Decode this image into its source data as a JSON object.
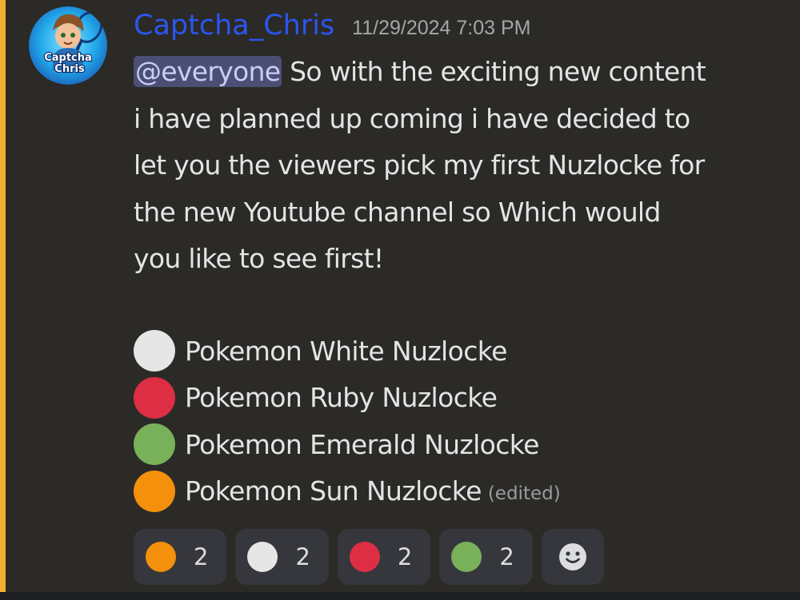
{
  "message": {
    "author": "Captcha_Chris",
    "timestamp": "11/29/2024 7:03 PM",
    "mention": "@everyone",
    "lines": [
      " So with the exciting new content",
      "i have planned up coming i have decided to",
      "let you the viewers pick my first Nuzlocke for",
      "the new Youtube channel so Which would",
      "you like to see first!"
    ],
    "avatar_text": [
      "Captcha",
      "Chris"
    ],
    "edited_label": "(edited)"
  },
  "options": [
    {
      "label": "Pokemon White Nuzlocke",
      "color": "#e6e6e6"
    },
    {
      "label": "Pokemon Ruby Nuzlocke",
      "color": "#dd2e44"
    },
    {
      "label": "Pokemon Emerald Nuzlocke",
      "color": "#78b159"
    },
    {
      "label": "Pokemon Sun Nuzlocke",
      "color": "#f4900c"
    }
  ],
  "reactions": [
    {
      "emoji": "orange-circle",
      "color": "#f4900c",
      "count": "2"
    },
    {
      "emoji": "white-circle",
      "color": "#e6e6e6",
      "count": "2"
    },
    {
      "emoji": "red-circle",
      "color": "#dd2e44",
      "count": "2"
    },
    {
      "emoji": "green-circle",
      "color": "#78b159",
      "count": "2"
    }
  ],
  "colors": {
    "background": "#2b2a26",
    "mention_bar": "#f0b232",
    "username": "#2c56f0",
    "mention_bg": "#4a4f73"
  }
}
